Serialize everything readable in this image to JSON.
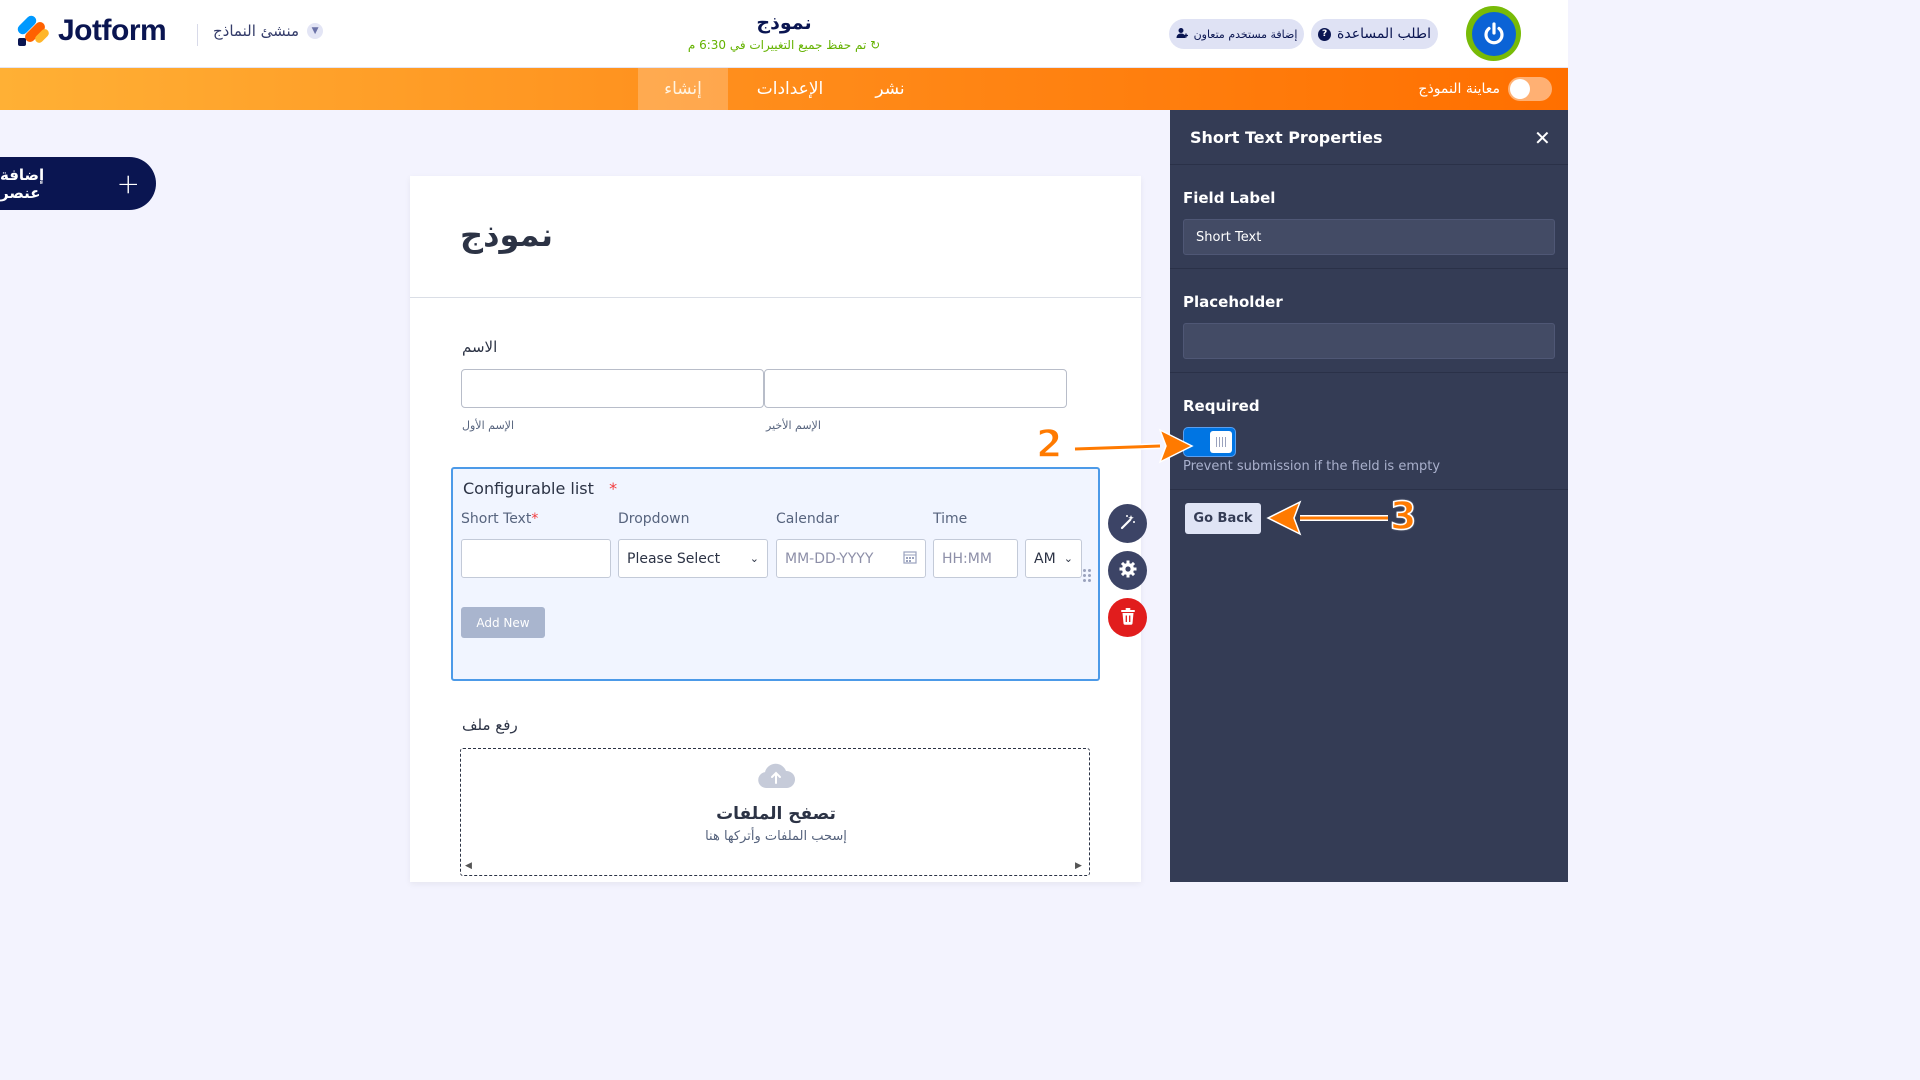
{
  "header": {
    "logo_text": "Jotform",
    "builder_menu": "منشئ النماذج",
    "form_title": "نموذج",
    "save_status": "تم حفظ جميع التغييرات في 6:30 م",
    "invite_label": "إضافة مستخدم متعاون",
    "help_label": "اطلب المساعدة"
  },
  "nav": {
    "tabs": [
      {
        "label": "إنشاء",
        "active": true
      },
      {
        "label": "الإعدادات",
        "active": false
      },
      {
        "label": "نشر",
        "active": false
      }
    ],
    "preview_label": "معاينة النموذج"
  },
  "add_element_label": "إضافة عنصر",
  "form": {
    "heading": "نموذج",
    "name_question": {
      "label": "الاسم",
      "first_sublabel": "الإسم الأول",
      "last_sublabel": "الإسم الأخير"
    },
    "config_list": {
      "title": "Configurable list",
      "columns": [
        {
          "label": "Short Text",
          "required": true
        },
        {
          "label": "Dropdown",
          "required": false
        },
        {
          "label": "Calendar",
          "required": false
        },
        {
          "label": "Time",
          "required": false
        }
      ],
      "dropdown_value": "Please Select",
      "calendar_placeholder": "MM-DD-YYYY",
      "time_placeholder": "HH:MM",
      "ampm_value": "AM",
      "add_new_label": "Add New"
    },
    "file_upload": {
      "label": "رفع ملف",
      "title": "تصفح الملفات",
      "subtitle": "إسحب الملفات وأتركها هنا"
    }
  },
  "panel": {
    "title": "Short Text Properties",
    "field_label_title": "Field Label",
    "field_label_value": "Short Text",
    "placeholder_title": "Placeholder",
    "placeholder_value": "",
    "required_title": "Required",
    "required_on": true,
    "required_help": "Prevent submission if the field is empty",
    "go_back_label": "Go Back"
  },
  "annotations": [
    "2",
    "3"
  ],
  "colors": {
    "nav_gradient_start": "#ffb035",
    "nav_gradient_end": "#ff6f00",
    "panel_bg": "#343c55",
    "accent_blue": "#0075e3",
    "annotation_orange": "#ff7a00"
  }
}
